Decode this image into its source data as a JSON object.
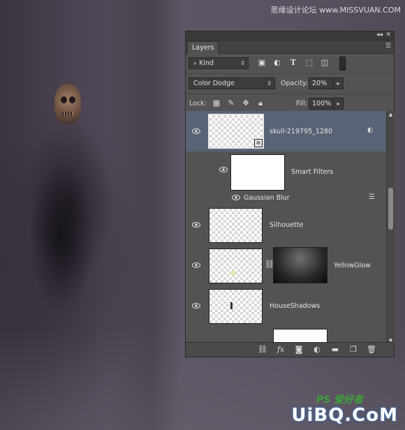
{
  "watermarks": {
    "top": "思缘设计论坛 www.MISSVUAN.COM",
    "bottom": "UiBQ.CoM",
    "ps": "PS 爱好者"
  },
  "panel": {
    "collapse_icon": "double-chevron-left-icon",
    "close_icon": "close-icon",
    "tab": "Layers",
    "menu_icon": "panel-menu-icon",
    "filter": {
      "kind_label": "Kind",
      "icons": [
        "image-filter-icon",
        "adjustment-filter-icon",
        "type-filter-icon",
        "shape-filter-icon",
        "smart-object-filter-icon",
        "filter-toggle-icon"
      ]
    },
    "blend": {
      "mode": "Color Dodge",
      "opacity_label": "Opacity:",
      "opacity_value": "20%"
    },
    "lock": {
      "label": "Lock:",
      "icons": [
        "lock-transparent-icon",
        "lock-image-icon",
        "lock-position-icon",
        "lock-all-icon"
      ],
      "fill_label": "Fill:",
      "fill_value": "100%"
    },
    "layers": [
      {
        "name": "skull-219795_1280",
        "selected": true,
        "smart_object": true
      },
      {
        "name": "Smart Filters"
      },
      {
        "name": "Gaussian Blur"
      },
      {
        "name": "Silhouette"
      },
      {
        "name": "YellowGlow"
      },
      {
        "name": "HouseShadows"
      }
    ],
    "bottom_icons": [
      "link-layers-icon",
      "fx-icon",
      "add-mask-icon",
      "adjustment-layer-icon",
      "new-group-icon",
      "new-layer-icon",
      "trash-icon"
    ],
    "fx_label": "fx"
  },
  "colors": {
    "panel_bg": "#535353",
    "selected_layer": "#5a6275",
    "canvas": "#5a5260"
  }
}
